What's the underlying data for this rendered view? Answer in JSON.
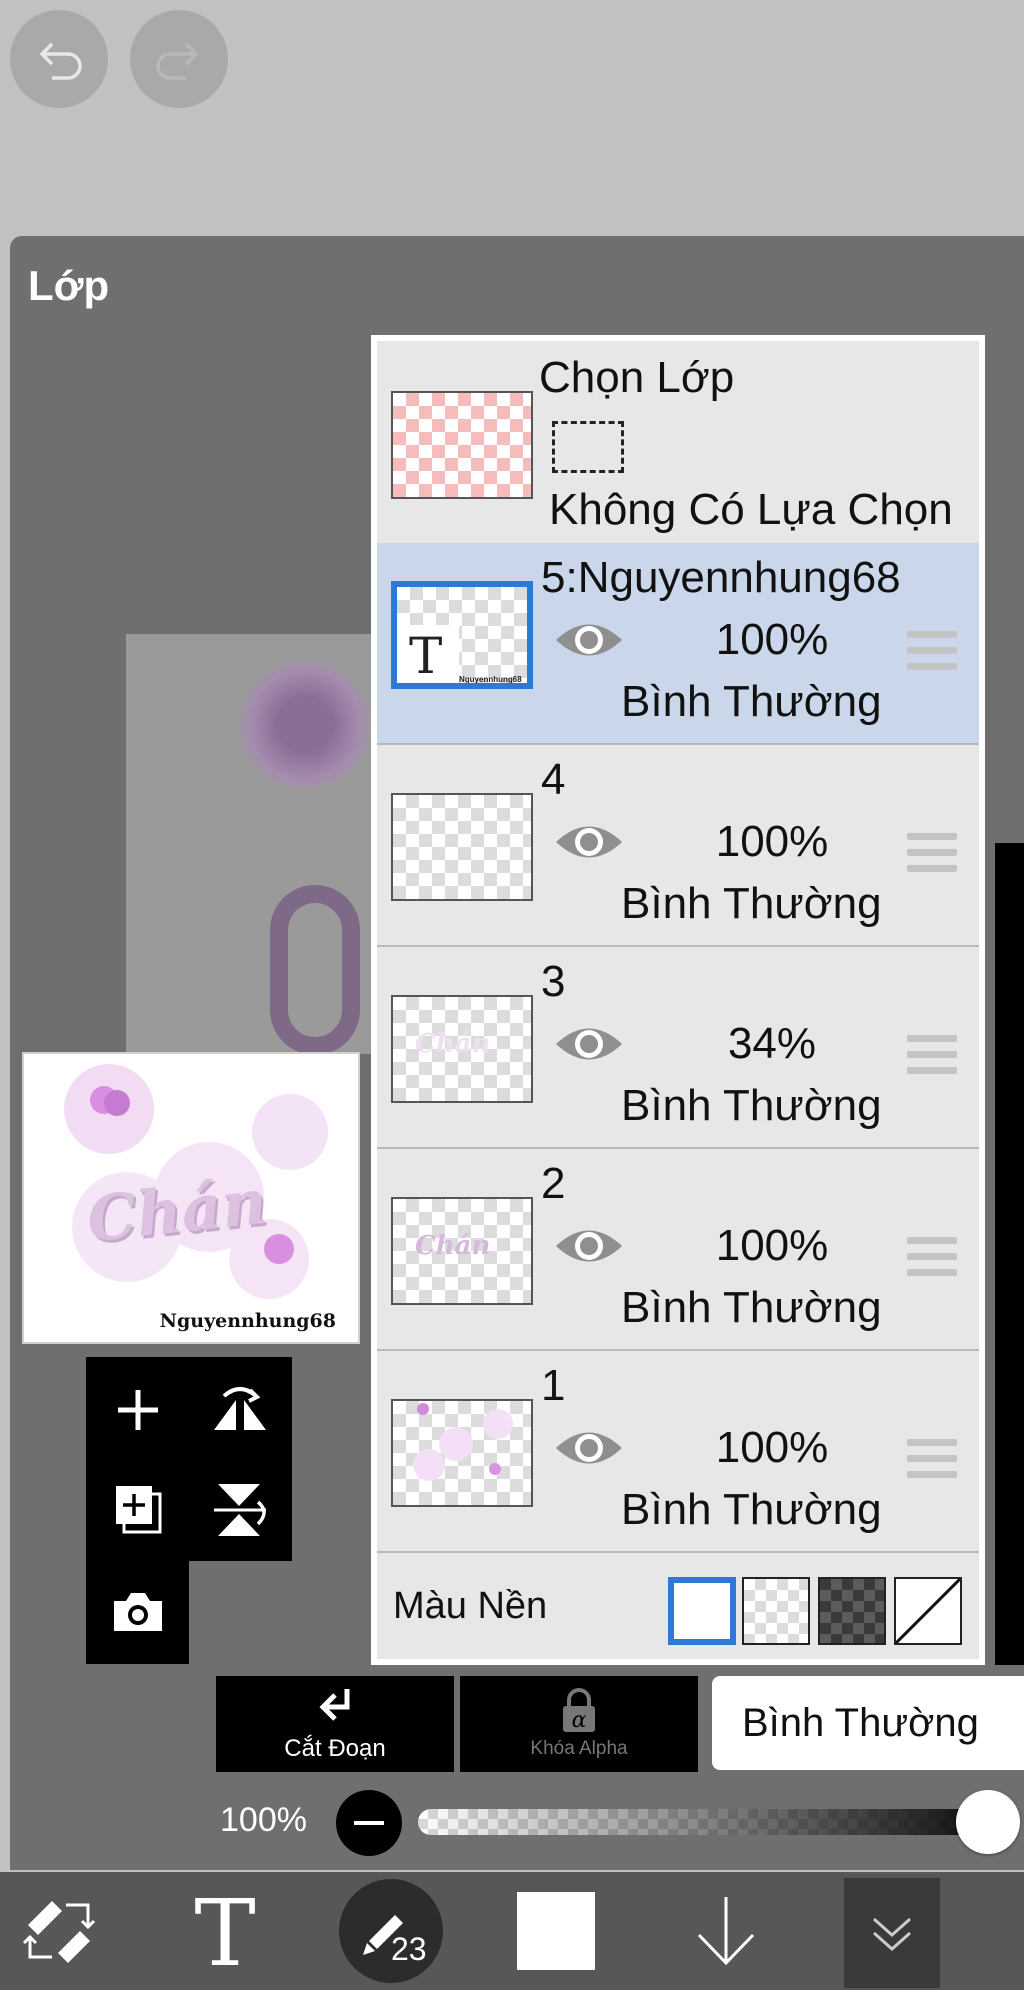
{
  "panel": {
    "title": "Lớp"
  },
  "preview": {
    "artwork_text": "Chán",
    "watermark": "Nguyennhung68"
  },
  "selection_row": {
    "title": "Chọn Lớp",
    "status": "Không Có Lựa Chọn"
  },
  "layers": [
    {
      "name": "5:Nguyennhung68",
      "opacity": "100%",
      "blend": "Bình Thường",
      "selected": true,
      "thumb_letter": "T",
      "thumb_caption": "Nguyennhung68"
    },
    {
      "name": "4",
      "opacity": "100%",
      "blend": "Bình Thường",
      "selected": false
    },
    {
      "name": "3",
      "opacity": "34%",
      "blend": "Bình Thường",
      "selected": false,
      "thumb_text": "Chán"
    },
    {
      "name": "2",
      "opacity": "100%",
      "blend": "Bình Thường",
      "selected": false,
      "thumb_text": "Chán"
    },
    {
      "name": "1",
      "opacity": "100%",
      "blend": "Bình Thường",
      "selected": false
    }
  ],
  "background": {
    "label": "Màu Nền",
    "options": [
      "white",
      "checker-light",
      "checker-dark",
      "none"
    ],
    "selected": "white"
  },
  "actions": {
    "clipping": "Cắt Đoạn",
    "alpha_lock": "Khóa Alpha",
    "blend_mode": "Bình Thường"
  },
  "opacity_slider": {
    "label": "100%",
    "value": 1.0
  },
  "toolbar": {
    "brush_size": "23",
    "icons": [
      "transform-icon",
      "text-icon",
      "brush-icon",
      "color-swatch",
      "move-down-icon",
      "collapse-icon"
    ],
    "current_color": "#ffffff"
  },
  "colors": {
    "accent": "#2f78d6",
    "selected_row": "#cad7ea",
    "panel": "#6f6f6f"
  }
}
